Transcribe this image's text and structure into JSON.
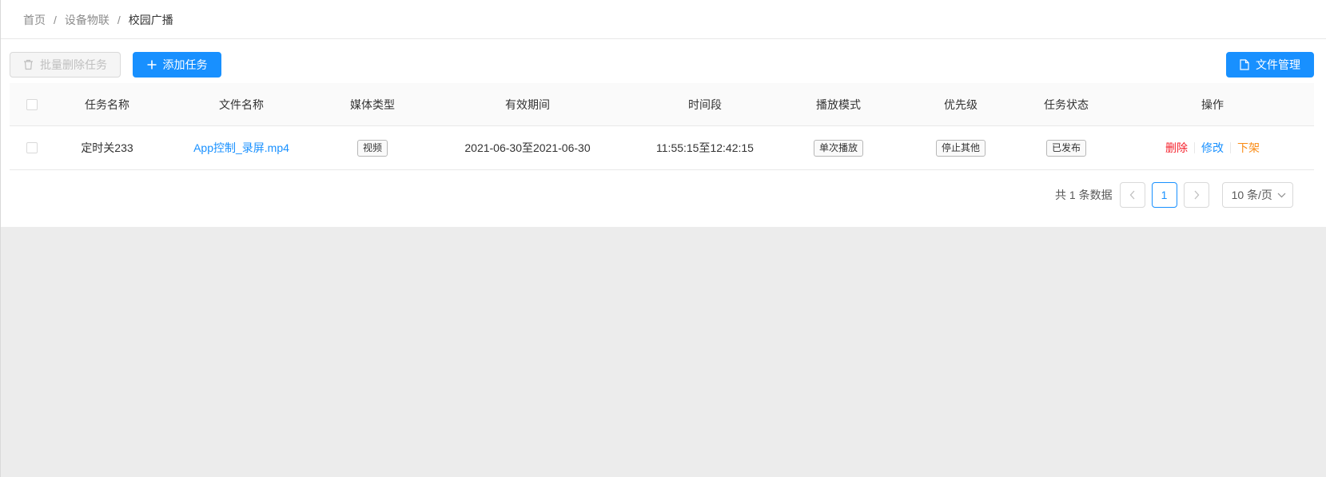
{
  "breadcrumb": {
    "items": [
      "首页",
      "设备物联",
      "校园广播"
    ],
    "separator": "/"
  },
  "toolbar": {
    "batch_delete_label": "批量删除任务",
    "add_task_label": "添加任务",
    "file_manage_label": "文件管理"
  },
  "table": {
    "columns": [
      "任务名称",
      "文件名称",
      "媒体类型",
      "有效期间",
      "时间段",
      "播放模式",
      "优先级",
      "任务状态",
      "操作"
    ],
    "rows": [
      {
        "task_name": "定时关233",
        "file_name": "App控制_录屏.mp4",
        "media_type": "视频",
        "valid_period": "2021-06-30至2021-06-30",
        "time_range": "11:55:15至12:42:15",
        "play_mode": "单次播放",
        "priority": "停止其他",
        "status": "已发布",
        "actions": {
          "delete": "删除",
          "edit": "修改",
          "offline": "下架"
        }
      }
    ]
  },
  "pagination": {
    "total_text": "共 1 条数据",
    "current_page": "1",
    "page_size": "10 条/页"
  },
  "colors": {
    "primary": "#1890ff",
    "danger": "#f5222d",
    "warning": "#fa8c16"
  },
  "icons": {
    "batch_delete": "trash-icon",
    "add": "plus-icon",
    "files": "file-icon",
    "prev": "chevron-left-icon",
    "next": "chevron-right-icon",
    "dropdown": "chevron-down-icon"
  }
}
